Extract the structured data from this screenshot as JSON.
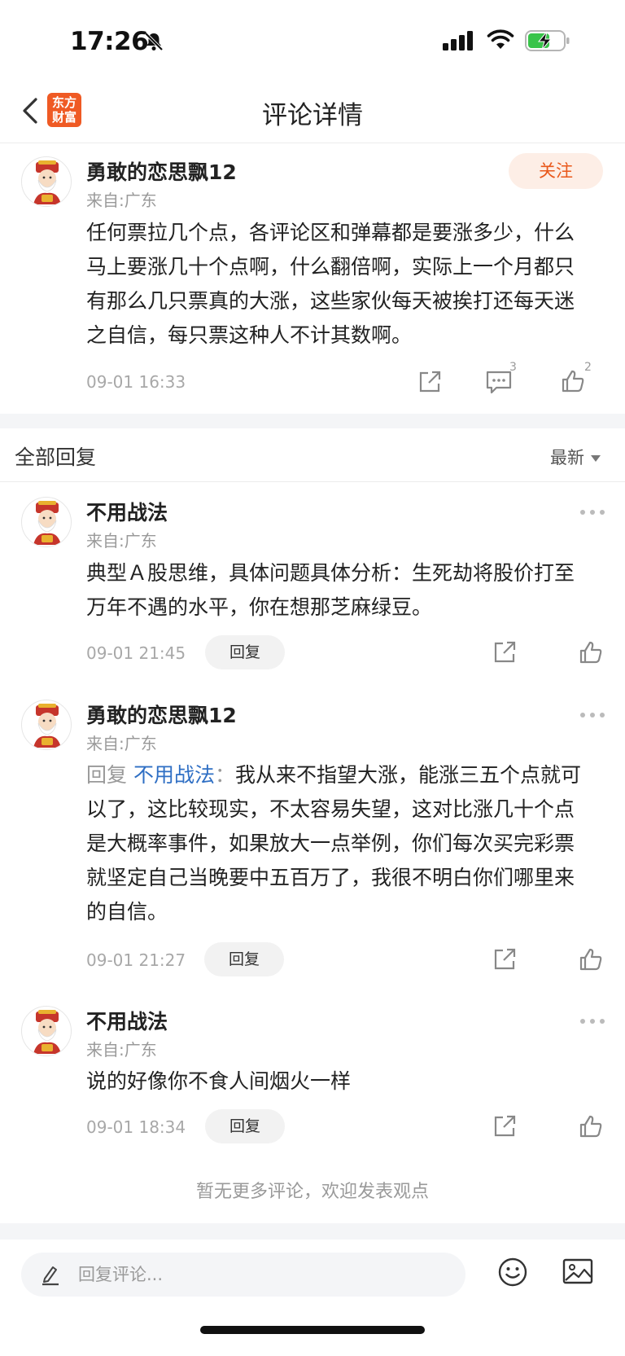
{
  "status_bar": {
    "time": "17:26"
  },
  "nav": {
    "title": "评论详情",
    "logo_text": "东方财富"
  },
  "main_comment": {
    "username": "勇敢的恋思飘12",
    "from": "来自:广东",
    "follow_label": "关注",
    "text": "任何票拉几个点，各评论区和弹幕都是要涨多少，什么马上要涨几十个点啊，什么翻倍啊，实际上一个月都只有那么几只票真的大涨，这些家伙每天被挨打还每天迷之自信，每只票这种人不计其数啊。",
    "time": "09-01 16:33",
    "comment_count": "3",
    "like_count": "2"
  },
  "section": {
    "title": "全部回复",
    "sort_label": "最新"
  },
  "replies": [
    {
      "username": "不用战法",
      "from": "来自:广东",
      "text": "典型Ａ股思维，具体问题具体分析：生死劫将股价打至万年不遇的水平，你在想那芝麻绿豆。",
      "time": "09-01 21:45",
      "reply_label": "回复"
    },
    {
      "username": "勇敢的恋思飘12",
      "from": "来自:广东",
      "reply_prefix": "回复",
      "reply_target": "不用战法",
      "reply_sep": "：",
      "text": "我从来不指望大涨，能涨三五个点就可以了，这比较现实，不太容易失望，这对比涨几十个点是大概率事件，如果放大一点举例，你们每次买完彩票就坚定自己当晚要中五百万了，我很不明白你们哪里来的自信。",
      "time": "09-01 21:27",
      "reply_label": "回复"
    },
    {
      "username": "不用战法",
      "from": "来自:广东",
      "text": "说的好像你不食人间烟火一样",
      "time": "09-01 18:34",
      "reply_label": "回复"
    }
  ],
  "footer": {
    "no_more": "暂无更多评论，欢迎发表观点"
  },
  "bottom_bar": {
    "input_placeholder": "回复评论..."
  },
  "colors": {
    "accent": "#ef5a24",
    "follow_bg": "#fdeee6",
    "link": "#2f6fc4",
    "muted": "#9a9a9a"
  }
}
